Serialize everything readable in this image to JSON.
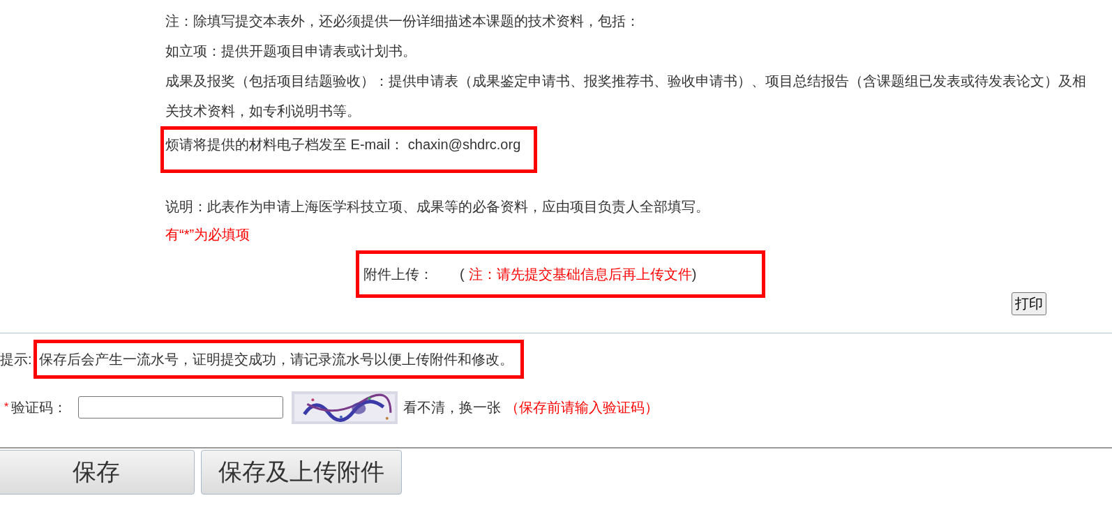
{
  "notes": [
    {
      "text": "注：除填写提交本表外，还必须提供一份详细描述本课题的技术资料，包括：",
      "highlighted": false
    },
    {
      "text": "如立项：提供开题项目申请表或计划书。",
      "highlighted": false
    },
    {
      "text": "成果及报奖（包括项目结题验收）：提供申请表（成果鉴定申请书、报奖推荐书、验收申请书）、项目总结报告（含课题组已发表或待发表论文）及相关技术资料，如专利说明书等。",
      "highlighted": false
    },
    {
      "text": "烦请将提供的材料电子档发至 E-mail：  chaxin@shdrc.org",
      "highlighted": true
    }
  ],
  "description": "说明：此表作为申请上海医学科技立项、成果等的必备资料，应由项目负责人全部填写。",
  "required_note": "有“*”为必填项",
  "attachment": {
    "label": "附件上传：",
    "note_open": "(",
    "note": "注：请先提交基础信息后再上传文件",
    "note_close": ")",
    "highlighted": true
  },
  "print_button": "打印",
  "hint": {
    "label": "提示:",
    "text": "保存后会产生一流水号，证明提交成功，请记录流水号以便上传附件和修改。",
    "highlighted": true
  },
  "captcha": {
    "required_mark": "*",
    "label": "验证码：",
    "refresh_link": "看不清，换一张",
    "note": "（保存前请输入验证码）"
  },
  "buttons": [
    "保存",
    "保存及上传附件"
  ]
}
